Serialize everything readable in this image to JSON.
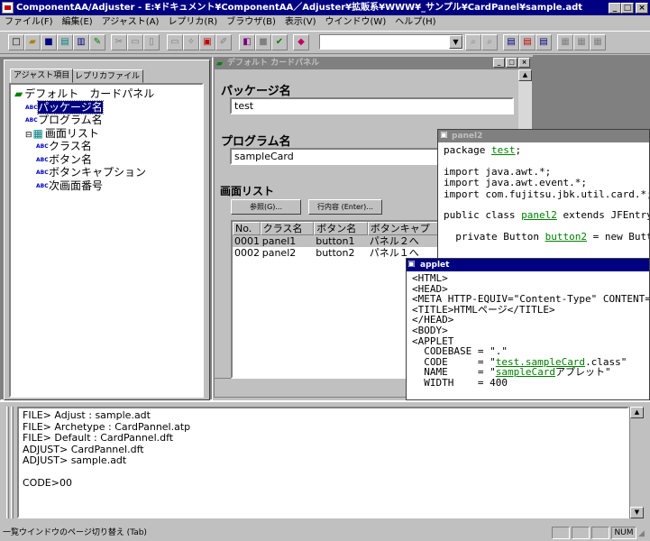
{
  "window": {
    "title": "ComponentAA/Adjuster - E:¥ドキュメント¥ComponentAA／Adjuster¥拡販系¥WWW¥_サンプル¥CardPanel¥sample.adt"
  },
  "menu": [
    "ファイル(F)",
    "編集(E)",
    "アジャスト(A)",
    "レプリカ(R)",
    "ブラウザ(B)",
    "表示(V)",
    "ウインドウ(W)",
    "ヘルプ(H)"
  ],
  "left_tabs": [
    "アジャスト項目",
    "レプリカファイル"
  ],
  "tree": [
    {
      "label": "デフォルト　カードパネル",
      "icon": "card-icon",
      "level": 0
    },
    {
      "label": "パッケージ名",
      "icon": "abc-icon",
      "level": 1,
      "selected": true
    },
    {
      "label": "プログラム名",
      "icon": "abc-icon",
      "level": 1
    },
    {
      "label": "画面リスト",
      "icon": "table-icon",
      "level": 1,
      "expander": "⊟"
    },
    {
      "label": "クラス名",
      "icon": "abc-icon",
      "level": 2
    },
    {
      "label": "ボタン名",
      "icon": "abc-icon",
      "level": 2
    },
    {
      "label": "ボタンキャプション",
      "icon": "abc-icon",
      "level": 2
    },
    {
      "label": "次画面番号",
      "icon": "abc-icon",
      "level": 2
    }
  ],
  "panel": {
    "title": "デフォルト カードパネル",
    "package_label": "パッケージ名",
    "package_value": "test",
    "program_label": "プログラム名",
    "program_value": "sampleCard",
    "screenlist_label": "画面リスト",
    "browse_button": "参照(G)...",
    "row_button": "行内容 (Enter)...",
    "columns": [
      "No.",
      "クラス名",
      "ボタン名",
      "ボタンキャプ"
    ],
    "rows": [
      [
        "0001",
        "panel1",
        "button1",
        "パネル２へ"
      ],
      [
        "0002",
        "panel2",
        "button2",
        "パネル１へ"
      ]
    ]
  },
  "panel2": {
    "title": "panel2",
    "lines": [
      {
        "text": "package ",
        "link": "test",
        "after": ";"
      },
      {
        "text": ""
      },
      {
        "text": "import java.awt.*;"
      },
      {
        "text": "import java.awt.event.*;"
      },
      {
        "text": "import com.fujitsu.jbk.util.card.*;"
      },
      {
        "text": ""
      },
      {
        "text": "public class ",
        "link": "panel2",
        "after": " extends JFEntry"
      },
      {
        "text": ""
      },
      {
        "text": "  private Button ",
        "link": "button2",
        "after": " = new Butt"
      }
    ]
  },
  "applet": {
    "title": "applet",
    "lines": [
      {
        "text": "<HTML>"
      },
      {
        "text": "<HEAD>"
      },
      {
        "text": "<META HTTP-EQUIV=\"Content-Type\" CONTENT=\""
      },
      {
        "text": "<TITLE>HTMLページ</TITLE>"
      },
      {
        "text": "</HEAD>"
      },
      {
        "text": "<BODY>"
      },
      {
        "text": "<APPLET"
      },
      {
        "text": "  CODEBASE = \".\""
      },
      {
        "text": "  CODE     = \"",
        "link": "test.sampleCard",
        "after": ".class\""
      },
      {
        "text": "  NAME     = \"",
        "link": "sampleCard",
        "after": "アプレット\""
      },
      {
        "text": "  WIDTH    = 400"
      }
    ]
  },
  "log": [
    "FILE> Adjust : sample.adt",
    "FILE> Archetype : CardPannel.atp",
    "FILE> Default : CardPannel.dft",
    "ADJUST> CardPannel.dft",
    "ADJUST> sample.adt",
    "",
    "CODE>00"
  ],
  "status": {
    "text": "一覧ウインドウのページ切り替え (Tab)",
    "num": "NUM"
  },
  "colors": {
    "title_active": "#000080",
    "title_inactive": "#808080",
    "link": "#008000",
    "face": "#c0c0c0"
  }
}
